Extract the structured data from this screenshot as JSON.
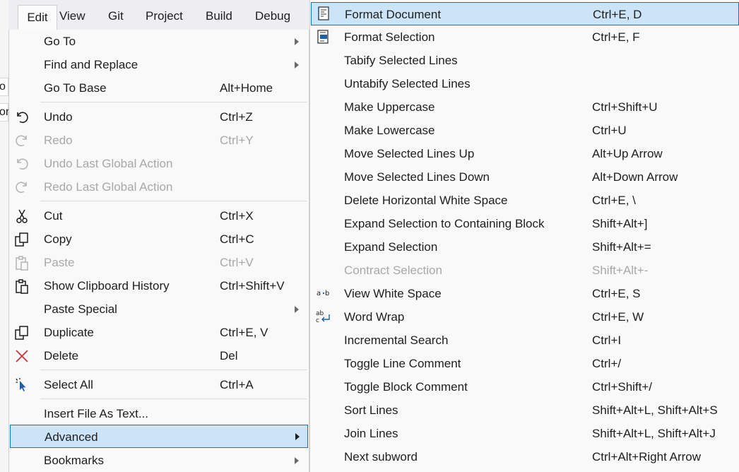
{
  "menubar": {
    "items": [
      "Edit",
      "View",
      "Git",
      "Project",
      "Build",
      "Debug"
    ]
  },
  "edit_menu": {
    "items": [
      {
        "label": "Go To",
        "shortcut": "",
        "icon": "",
        "submenu": true,
        "disabled": false
      },
      {
        "label": "Find and Replace",
        "shortcut": "",
        "icon": "",
        "submenu": true,
        "disabled": false
      },
      {
        "label": "Go To Base",
        "shortcut": "Alt+Home",
        "icon": "",
        "submenu": false,
        "disabled": false
      },
      {
        "label": "Undo",
        "shortcut": "Ctrl+Z",
        "icon": "undo-icon",
        "submenu": false,
        "disabled": false
      },
      {
        "label": "Redo",
        "shortcut": "Ctrl+Y",
        "icon": "redo-icon",
        "submenu": false,
        "disabled": true
      },
      {
        "label": "Undo Last Global Action",
        "shortcut": "",
        "icon": "undo-icon",
        "submenu": false,
        "disabled": true
      },
      {
        "label": "Redo Last Global Action",
        "shortcut": "",
        "icon": "redo-icon",
        "submenu": false,
        "disabled": true
      },
      {
        "label": "Cut",
        "shortcut": "Ctrl+X",
        "icon": "cut-icon",
        "submenu": false,
        "disabled": false
      },
      {
        "label": "Copy",
        "shortcut": "Ctrl+C",
        "icon": "copy-icon",
        "submenu": false,
        "disabled": false
      },
      {
        "label": "Paste",
        "shortcut": "Ctrl+V",
        "icon": "paste-icon",
        "submenu": false,
        "disabled": true
      },
      {
        "label": "Show Clipboard History",
        "shortcut": "Ctrl+Shift+V",
        "icon": "clipboard-history-icon",
        "submenu": false,
        "disabled": false
      },
      {
        "label": "Paste Special",
        "shortcut": "",
        "icon": "",
        "submenu": true,
        "disabled": false
      },
      {
        "label": "Duplicate",
        "shortcut": "Ctrl+E, V",
        "icon": "duplicate-icon",
        "submenu": false,
        "disabled": false
      },
      {
        "label": "Delete",
        "shortcut": "Del",
        "icon": "delete-icon",
        "submenu": false,
        "disabled": false
      },
      {
        "label": "Select All",
        "shortcut": "Ctrl+A",
        "icon": "select-all-icon",
        "submenu": false,
        "disabled": false
      },
      {
        "label": "Insert File As Text...",
        "shortcut": "",
        "icon": "",
        "submenu": false,
        "disabled": false
      },
      {
        "label": "Advanced",
        "shortcut": "",
        "icon": "",
        "submenu": true,
        "disabled": false,
        "selected": true
      },
      {
        "label": "Bookmarks",
        "shortcut": "",
        "icon": "",
        "submenu": true,
        "disabled": false
      }
    ]
  },
  "advanced_menu": {
    "items": [
      {
        "label": "Format Document",
        "shortcut": "Ctrl+E, D",
        "icon": "format-document-icon",
        "selected": true
      },
      {
        "label": "Format Selection",
        "shortcut": "Ctrl+E, F",
        "icon": "format-selection-icon"
      },
      {
        "label": "Tabify Selected Lines",
        "shortcut": ""
      },
      {
        "label": "Untabify Selected Lines",
        "shortcut": ""
      },
      {
        "label": "Make Uppercase",
        "shortcut": "Ctrl+Shift+U"
      },
      {
        "label": "Make Lowercase",
        "shortcut": "Ctrl+U"
      },
      {
        "label": "Move Selected Lines Up",
        "shortcut": "Alt+Up Arrow"
      },
      {
        "label": "Move Selected Lines Down",
        "shortcut": "Alt+Down Arrow"
      },
      {
        "label": "Delete Horizontal White Space",
        "shortcut": "Ctrl+E, \\"
      },
      {
        "label": "Expand Selection to Containing Block",
        "shortcut": "Shift+Alt+]"
      },
      {
        "label": "Expand Selection",
        "shortcut": "Shift+Alt+="
      },
      {
        "label": "Contract Selection",
        "shortcut": "Shift+Alt+-",
        "disabled": true
      },
      {
        "label": "View White Space",
        "shortcut": "Ctrl+E, S",
        "icon": "view-white-space-icon"
      },
      {
        "label": "Word Wrap",
        "shortcut": "Ctrl+E, W",
        "icon": "word-wrap-icon"
      },
      {
        "label": "Incremental Search",
        "shortcut": "Ctrl+I"
      },
      {
        "label": "Toggle Line Comment",
        "shortcut": "Ctrl+/"
      },
      {
        "label": "Toggle Block Comment",
        "shortcut": "Ctrl+Shift+/"
      },
      {
        "label": "Sort Lines",
        "shortcut": "Shift+Alt+L, Shift+Alt+S"
      },
      {
        "label": "Join Lines",
        "shortcut": "Shift+Alt+L, Shift+Alt+J"
      },
      {
        "label": "Next subword",
        "shortcut": "Ctrl+Alt+Right Arrow"
      }
    ]
  },
  "background": {
    "fragments": [
      "o",
      "or"
    ]
  },
  "colors": {
    "highlight": "#cce4f7",
    "highlight_border": "#0078d4",
    "delete_red": "#d13438",
    "accent_blue": "#1c5fa8"
  }
}
